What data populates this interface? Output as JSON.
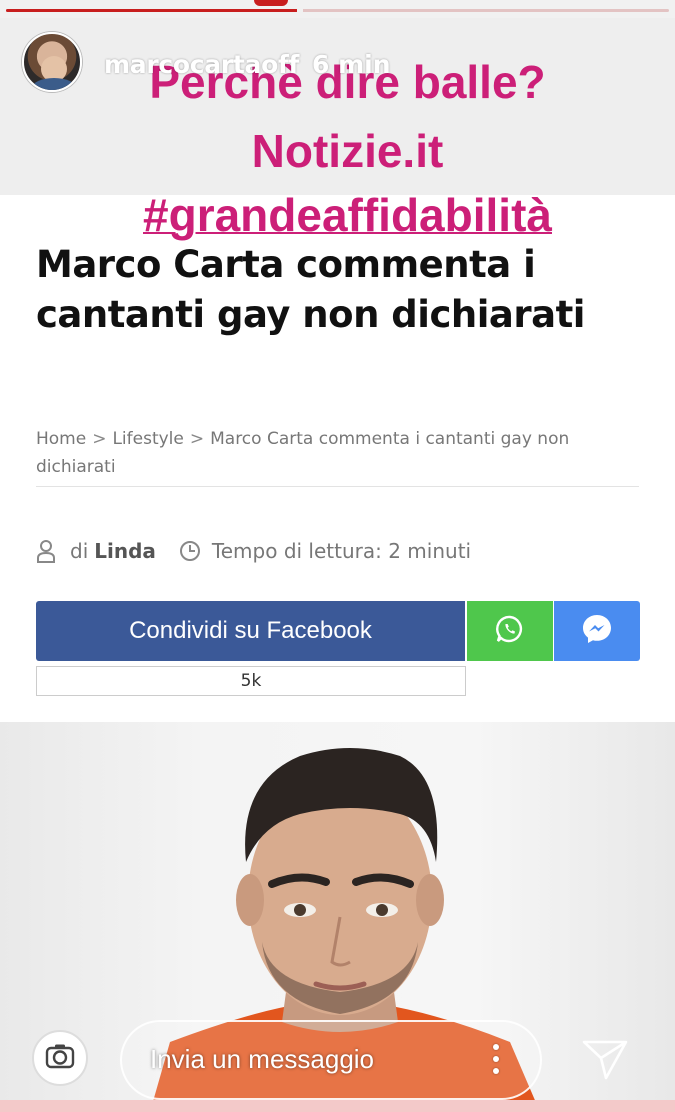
{
  "story": {
    "username": "marcocartaoff",
    "time_ago": "6 min",
    "progress": 0.44,
    "accent_color": "#c81e1e"
  },
  "caption": {
    "line1": "Perchè dire balle?",
    "line2": "Notizie.it",
    "line3": "#grandeaffidabilità",
    "color": "#cc1f78"
  },
  "article": {
    "title_line1": "Marco Carta commenta i",
    "title_line2": "cantanti gay non dichiarati",
    "breadcrumb": {
      "home": "Home",
      "separator": ">",
      "category": "Lifestyle",
      "current_line1": "Marco Carta commenta i cantanti gay non",
      "current_line2": "dichiarati"
    },
    "meta": {
      "author_prefix": "di",
      "author": "Linda",
      "reading_time": "Tempo di lettura: 2 minuti",
      "user_icon": "user-icon",
      "clock_icon": "clock-icon"
    },
    "share": {
      "facebook_label": "Condividi su Facebook",
      "facebook_color": "#3b5998",
      "whatsapp_icon": "whatsapp-icon",
      "whatsapp_color": "#4fc74c",
      "messenger_icon": "messenger-icon",
      "messenger_color": "#4a8cf0",
      "count": "5k"
    }
  },
  "bottom_bar": {
    "camera_icon": "camera-icon",
    "message_placeholder": "Invia un messaggio",
    "more_icon": "more-vertical-icon",
    "send_icon": "send-icon"
  }
}
